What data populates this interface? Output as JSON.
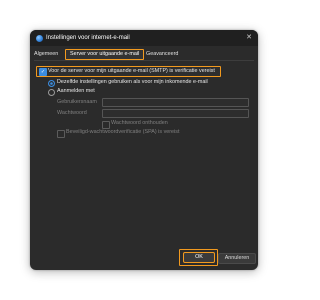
{
  "window": {
    "title": "Instellingen voor internet-e-mail",
    "close_glyph": "✕",
    "app_icon": "outlook-globe-icon"
  },
  "tabs": [
    {
      "label": "Algemeen",
      "selected": false
    },
    {
      "label": "Server voor uitgaande e-mail",
      "selected": true
    },
    {
      "label": "Geavanceerd",
      "selected": false
    }
  ],
  "outgoing": {
    "smtp_auth_label": "Voor de server voor mijn uitgaande e-mail (SMTP) is verificatie vereist",
    "smtp_auth_checked": true,
    "same_settings_label": "Dezelfde instellingen gebruiken als voor mijn inkomende e-mail",
    "same_settings_selected": true,
    "login_with_label": "Aanmelden met",
    "login_with_selected": false,
    "username_label": "Gebruikersnaam",
    "username_value": "",
    "password_label": "Wachtwoord",
    "password_value": "",
    "remember_password_label": "Wachtwoord onthouden",
    "remember_password_checked": false,
    "spa_label": "Beveiligd-wachtwoordverificatie (SPA) is vereist",
    "spa_checked": false
  },
  "buttons": {
    "ok_label": "OK",
    "cancel_label": "Annuleren"
  },
  "colors": {
    "highlight": "#f29a1f",
    "accent": "#3b8de0",
    "dialog_bg": "#2b2b2b"
  }
}
